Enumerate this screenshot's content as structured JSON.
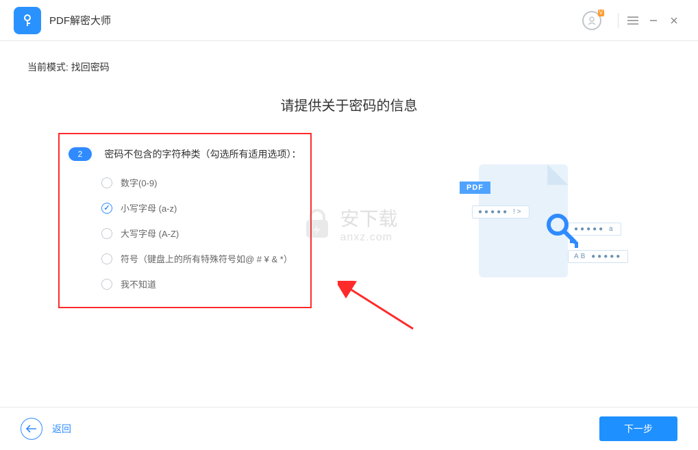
{
  "header": {
    "title": "PDF解密大师",
    "user_badge": "V"
  },
  "mode": {
    "label": "当前模式:",
    "value": "找回密码"
  },
  "main_title": "请提供关于密码的信息",
  "step": {
    "number": "2",
    "question": "密码不包含的字符种类（勾选所有适用选项）："
  },
  "options": [
    {
      "label": "数字(0-9)",
      "checked": false
    },
    {
      "label": "小写字母 (a-z)",
      "checked": true
    },
    {
      "label": "大写字母 (A-Z)",
      "checked": false
    },
    {
      "label": "符号（键盘上的所有特殊符号如@ # ¥ & *）",
      "checked": false
    },
    {
      "label": "我不知道",
      "checked": false
    }
  ],
  "illustration": {
    "pdf_label": "PDF",
    "bar1": "●●●●● !>",
    "bar2": "●●●●● a",
    "bar3": "AB ●●●●●"
  },
  "watermark": {
    "title": "安下载",
    "url": "anxz.com"
  },
  "footer": {
    "back": "返回",
    "next": "下一步"
  }
}
